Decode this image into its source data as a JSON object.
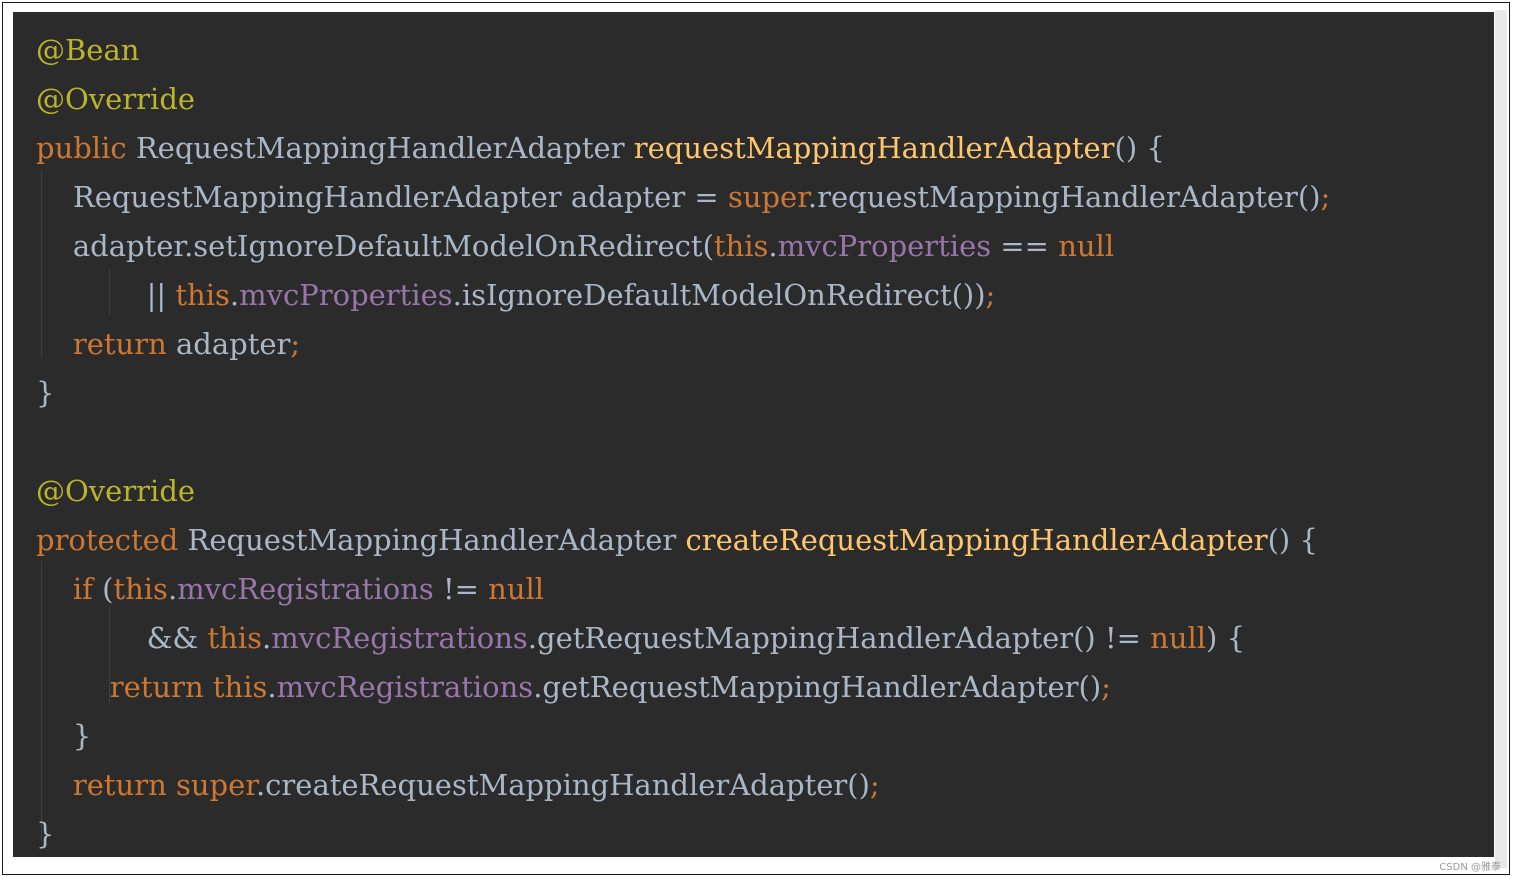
{
  "colors": {
    "background": "#2b2b2b",
    "annotation": "#bbb529",
    "keyword": "#cc7832",
    "method_declaration": "#ffc66d",
    "field": "#9876aa",
    "plain": "#a9b7c6"
  },
  "code_lines": [
    [
      {
        "t": "@Bean",
        "c": "ann"
      }
    ],
    [
      {
        "t": "@Override",
        "c": "ann"
      }
    ],
    [
      {
        "t": "public",
        "c": "kw"
      },
      {
        "t": " RequestMappingHandlerAdapter ",
        "c": "plain"
      },
      {
        "t": "requestMappingHandlerAdapter",
        "c": "fn"
      },
      {
        "t": "() {",
        "c": "plain"
      }
    ],
    [
      {
        "t": "    RequestMappingHandlerAdapter adapter = ",
        "c": "plain"
      },
      {
        "t": "super",
        "c": "kw"
      },
      {
        "t": ".requestMappingHandlerAdapter()",
        "c": "plain"
      },
      {
        "t": ";",
        "c": "kw"
      }
    ],
    [
      {
        "t": "    adapter.setIgnoreDefaultModelOnRedirect(",
        "c": "plain"
      },
      {
        "t": "this",
        "c": "kw"
      },
      {
        "t": ".",
        "c": "plain"
      },
      {
        "t": "mvcProperties",
        "c": "field"
      },
      {
        "t": " == ",
        "c": "plain"
      },
      {
        "t": "null",
        "c": "kw"
      }
    ],
    [
      {
        "t": "            || ",
        "c": "plain"
      },
      {
        "t": "this",
        "c": "kw"
      },
      {
        "t": ".",
        "c": "plain"
      },
      {
        "t": "mvcProperties",
        "c": "field"
      },
      {
        "t": ".isIgnoreDefaultModelOnRedirect())",
        "c": "plain"
      },
      {
        "t": ";",
        "c": "kw"
      }
    ],
    [
      {
        "t": "    ",
        "c": "plain"
      },
      {
        "t": "return",
        "c": "kw"
      },
      {
        "t": " adapter",
        "c": "plain"
      },
      {
        "t": ";",
        "c": "kw"
      }
    ],
    [
      {
        "t": "}",
        "c": "plain"
      }
    ],
    [],
    [
      {
        "t": "@Override",
        "c": "ann"
      }
    ],
    [
      {
        "t": "protected",
        "c": "kw"
      },
      {
        "t": " RequestMappingHandlerAdapter ",
        "c": "plain"
      },
      {
        "t": "createRequestMappingHandlerAdapter",
        "c": "fn"
      },
      {
        "t": "() {",
        "c": "plain"
      }
    ],
    [
      {
        "t": "    ",
        "c": "plain"
      },
      {
        "t": "if",
        "c": "kw"
      },
      {
        "t": " (",
        "c": "plain"
      },
      {
        "t": "this",
        "c": "kw"
      },
      {
        "t": ".",
        "c": "plain"
      },
      {
        "t": "mvcRegistrations",
        "c": "field"
      },
      {
        "t": " != ",
        "c": "plain"
      },
      {
        "t": "null",
        "c": "kw"
      }
    ],
    [
      {
        "t": "            && ",
        "c": "plain"
      },
      {
        "t": "this",
        "c": "kw"
      },
      {
        "t": ".",
        "c": "plain"
      },
      {
        "t": "mvcRegistrations",
        "c": "field"
      },
      {
        "t": ".getRequestMappingHandlerAdapter() != ",
        "c": "plain"
      },
      {
        "t": "null",
        "c": "kw"
      },
      {
        "t": ") {",
        "c": "plain"
      }
    ],
    [
      {
        "t": "        ",
        "c": "plain"
      },
      {
        "t": "return",
        "c": "kw"
      },
      {
        "t": " ",
        "c": "plain"
      },
      {
        "t": "this",
        "c": "kw"
      },
      {
        "t": ".",
        "c": "plain"
      },
      {
        "t": "mvcRegistrations",
        "c": "field"
      },
      {
        "t": ".getRequestMappingHandlerAdapter()",
        "c": "plain"
      },
      {
        "t": ";",
        "c": "kw"
      }
    ],
    [
      {
        "t": "    }",
        "c": "plain"
      }
    ],
    [
      {
        "t": "    ",
        "c": "plain"
      },
      {
        "t": "return",
        "c": "kw"
      },
      {
        "t": " ",
        "c": "plain"
      },
      {
        "t": "super",
        "c": "kw"
      },
      {
        "t": ".createRequestMappingHandlerAdapter()",
        "c": "plain"
      },
      {
        "t": ";",
        "c": "kw"
      }
    ],
    [
      {
        "t": "}",
        "c": "plain"
      }
    ]
  ],
  "watermark": "CSDN @雅泰"
}
